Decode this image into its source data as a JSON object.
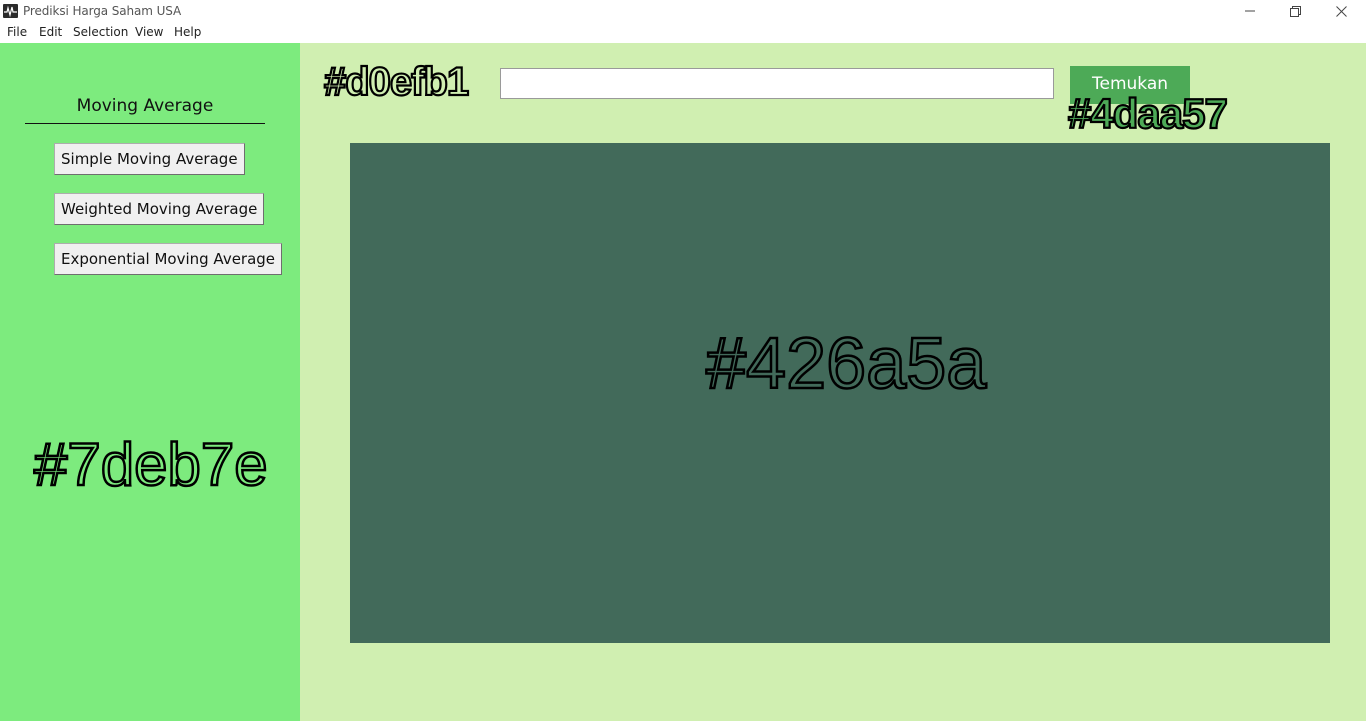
{
  "window": {
    "title": "Prediksi Harga Saham USA",
    "controls": [
      "minimize-icon",
      "restore-icon",
      "close-icon"
    ]
  },
  "menu": {
    "items": [
      "File",
      "Edit",
      "Selection",
      "View",
      "Help"
    ]
  },
  "sidebar": {
    "heading": "Moving Average",
    "buttons": [
      {
        "label": "Simple Moving Average"
      },
      {
        "label": "Weighted Moving Average"
      },
      {
        "label": "Exponential Moving Average"
      }
    ],
    "color_label": "#7deb7e"
  },
  "main": {
    "search": {
      "value": "",
      "placeholder": ""
    },
    "find_button": {
      "label": "Temukan"
    },
    "color_label": "#d0efb1",
    "find_button_color_label": "#4daa57",
    "chart_panel_color_label": "#426a5a"
  },
  "colors": {
    "sidebar": "#7deb7e",
    "main": "#d0efb1",
    "button": "#4daa57",
    "panel": "#426a5a"
  }
}
